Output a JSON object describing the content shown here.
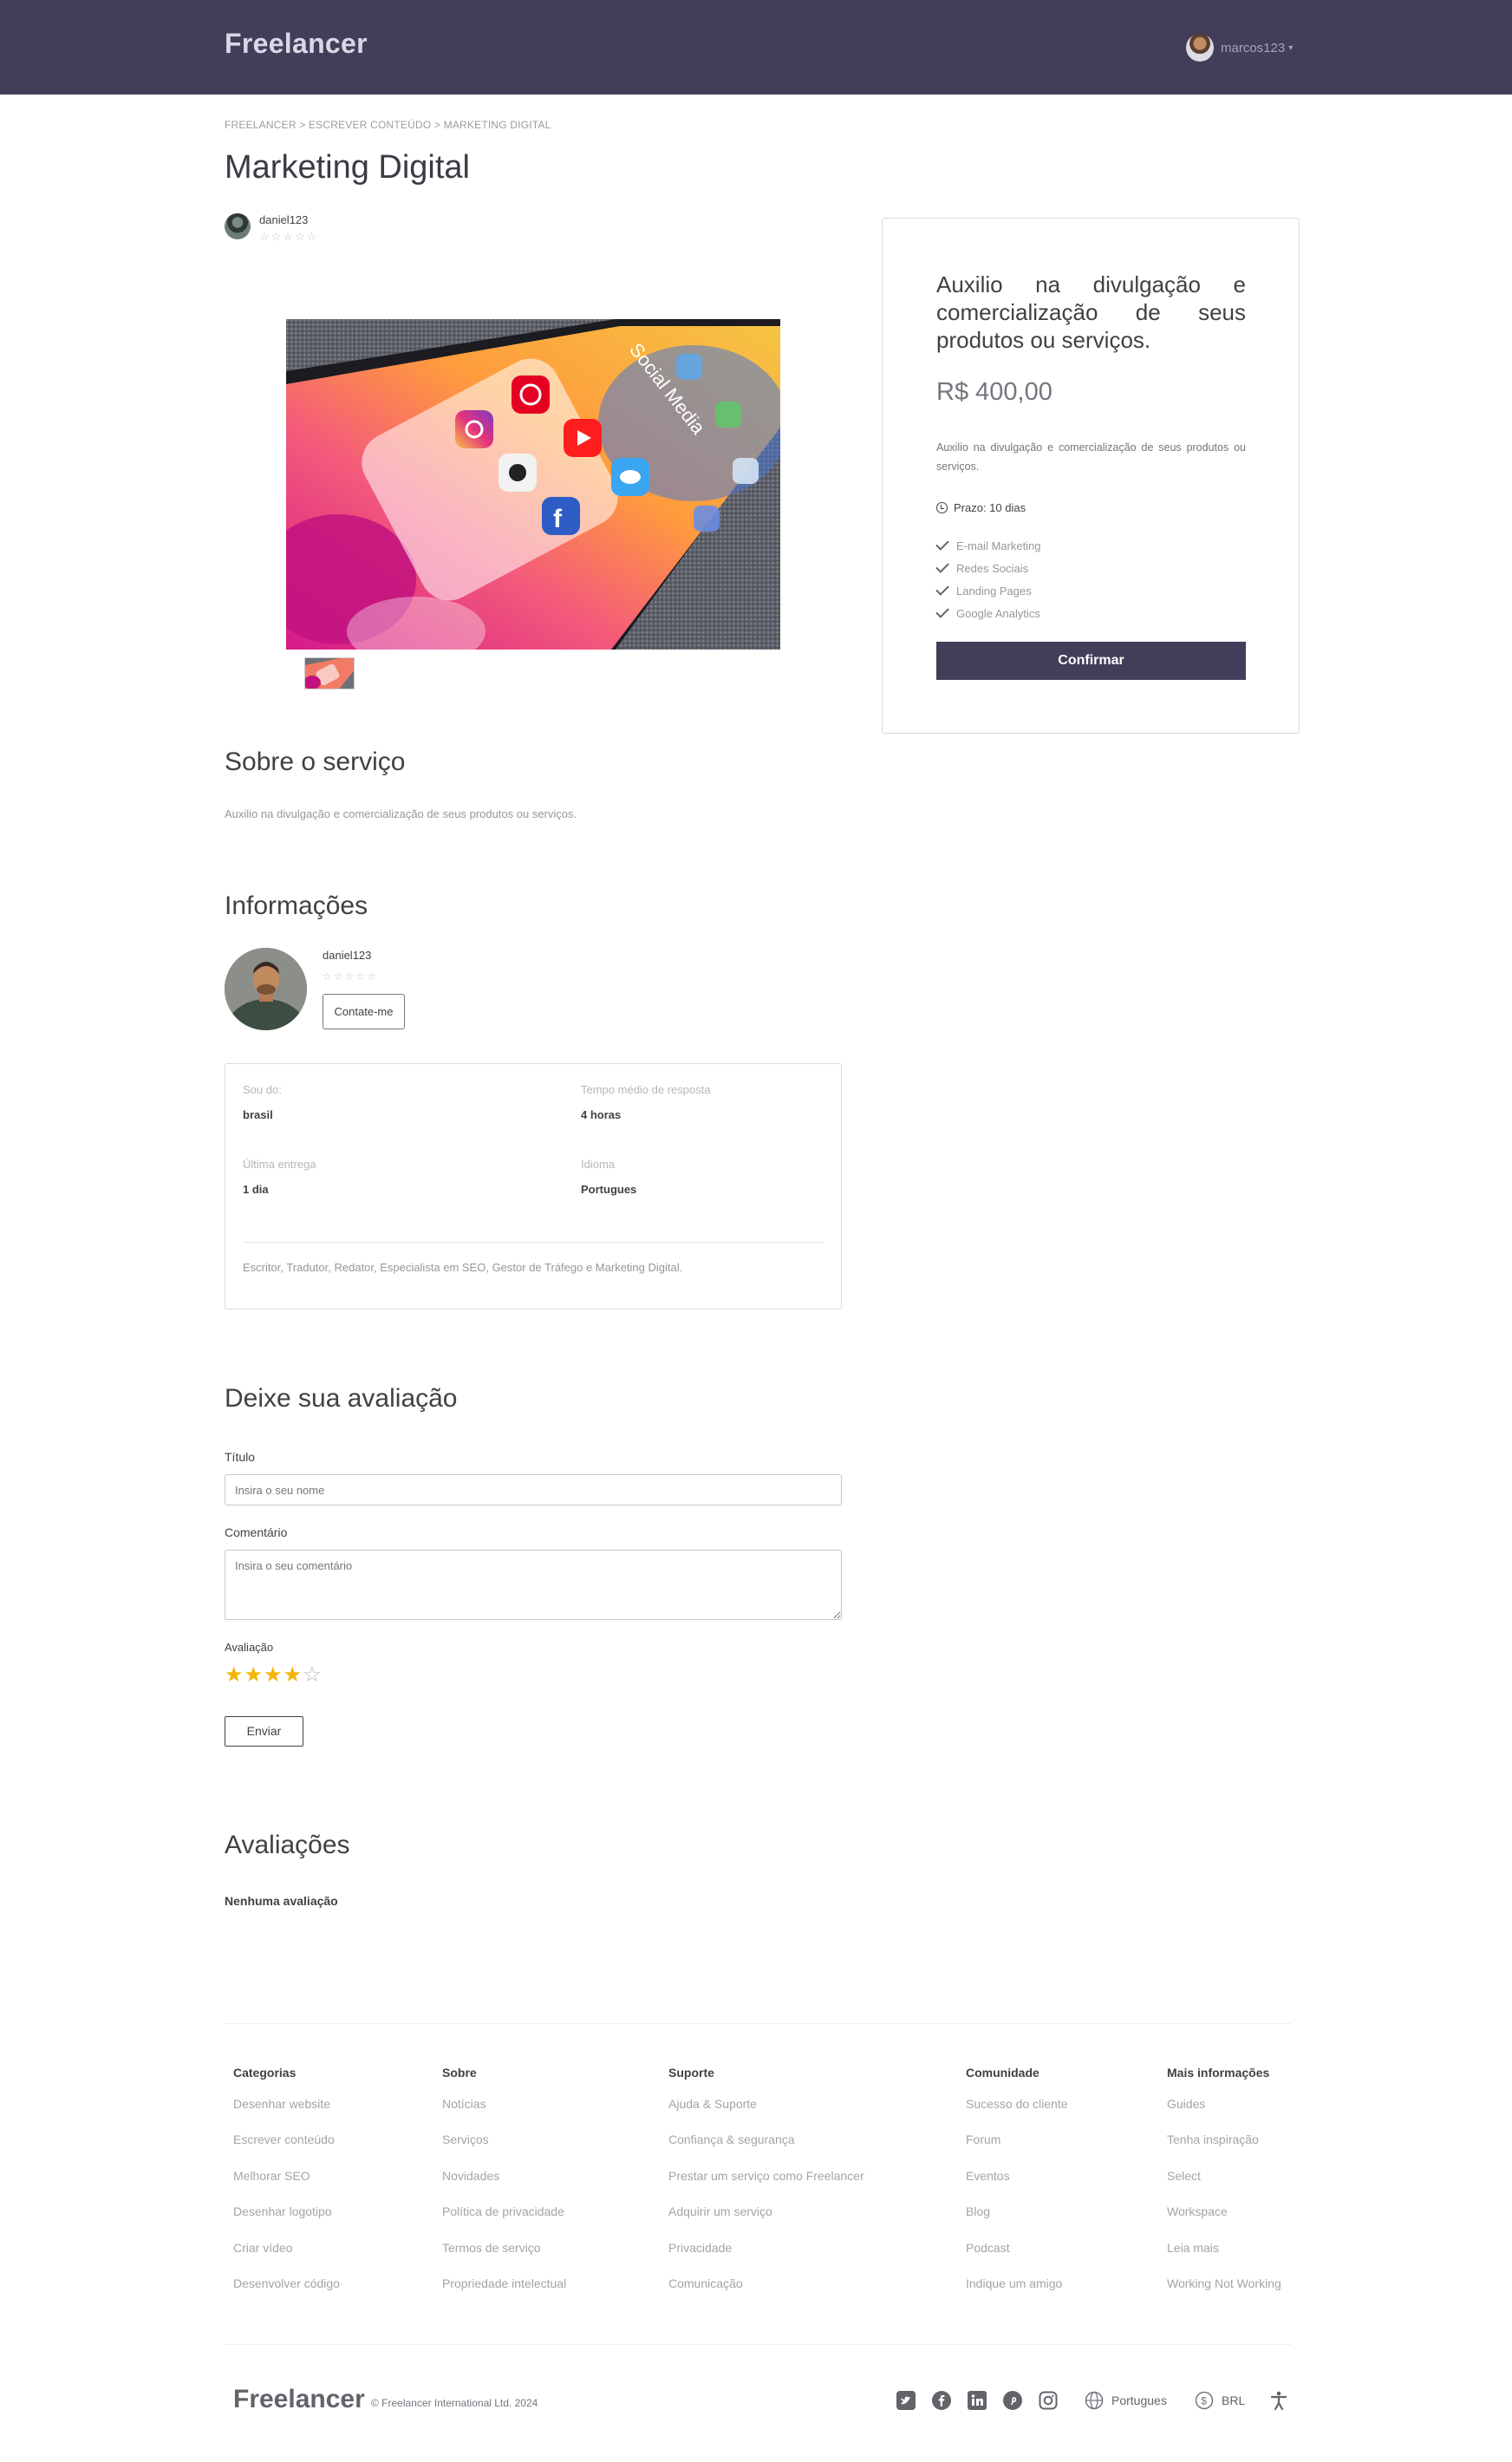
{
  "header": {
    "logo": "Freelancer",
    "username": "marcos123",
    "caret": "▾"
  },
  "breadcrumb": "FREELANCER > ESCREVER CONTEÚDO > MARKETING DIGITAL",
  "page_title": "Marketing Digital",
  "seller": {
    "name": "daniel123",
    "stars": "☆☆☆☆☆"
  },
  "gallery": {
    "main_image_label": "Social Media"
  },
  "package": {
    "title": "Auxilio na divulgação e comercialização de seus produtos ou serviços.",
    "price": "R$ 400,00",
    "description": "Auxilio na divulgação e comercialização de seus produtos ou serviços.",
    "deadline": "Prazo: 10 dias",
    "features": [
      "E-mail Marketing",
      "Redes Sociais",
      "Landing Pages",
      "Google Analytics"
    ],
    "confirm_label": "Confirmar",
    "accent_color": "#433d59"
  },
  "about": {
    "heading": "Sobre o serviço",
    "text": "Auxilio na divulgação e comercialização de seus produtos ou serviços."
  },
  "info": {
    "heading": "Informações",
    "name": "daniel123",
    "stars": "☆☆☆☆☆",
    "contact_label": "Contate-me",
    "from_label": "Sou do:",
    "from_value": "brasil",
    "response_label": "Tempo médio de resposta",
    "response_value": "4 horas",
    "delivery_label": "Última entrega",
    "delivery_value": "1 dia",
    "language_label": "Idioma",
    "language_value": "Portugues",
    "bio": "Escritor, Tradutor, Redator, Especialista em SEO, Gestor de Tráfego e Marketing Digital."
  },
  "review_form": {
    "heading": "Deixe sua avaliação",
    "title_label": "Título",
    "title_placeholder": "Insira o seu nome",
    "comment_label": "Comentário",
    "comment_placeholder": "Insira o seu comentário",
    "rating_label": "Avaliação",
    "rating_value": 4,
    "rating_max": 5,
    "submit_label": "Enviar"
  },
  "reviews": {
    "heading": "Avaliações",
    "empty_text": "Nenhuma avaliação"
  },
  "footer": {
    "columns": [
      {
        "title": "Categorias",
        "links": [
          "Desenhar website",
          "Escrever conteúdo",
          "Melhorar SEO",
          "Desenhar logotipo",
          "Criar vídeo",
          "Desenvolver código"
        ]
      },
      {
        "title": "Sobre",
        "links": [
          "Notícias",
          "Serviços",
          "Novidades",
          "Política de privacidade",
          "Termos de serviço",
          "Propriedade intelectual"
        ]
      },
      {
        "title": "Suporte",
        "links": [
          "Ajuda & Suporte",
          "Confiança & segurança",
          "Prestar um serviço como Freelancer",
          "Adquirir um serviço",
          "Privacidade",
          "Comunicação"
        ]
      },
      {
        "title": "Comunidade",
        "links": [
          "Sucesso do cliente",
          "Forum",
          "Eventos",
          "Blog",
          "Podcast",
          "Indique um amigo"
        ]
      },
      {
        "title": "Mais informações",
        "links": [
          "Guides",
          "Tenha inspiração",
          "Select",
          "Workspace",
          "Leia mais",
          "Working Not Working"
        ]
      }
    ],
    "logo": "Freelancer",
    "copyright": "© Freelancer International Ltd. 2024",
    "socials": [
      "twitter-icon",
      "facebook-icon",
      "linkedin-icon",
      "pinterest-icon",
      "instagram-icon"
    ],
    "language": "Portugues",
    "currency": "BRL"
  }
}
